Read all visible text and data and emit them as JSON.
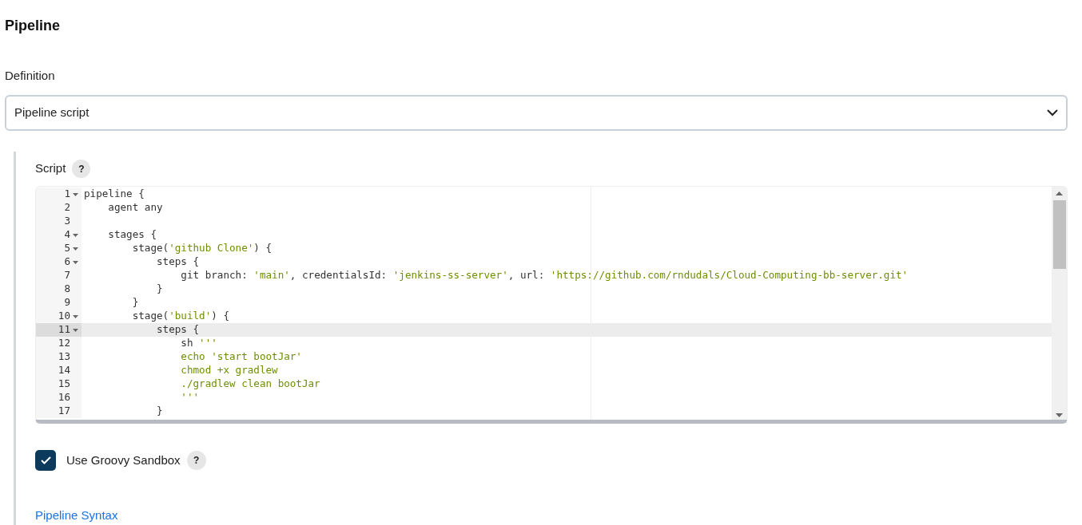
{
  "section_title": "Pipeline",
  "definition": {
    "label": "Definition",
    "value": "Pipeline script"
  },
  "script": {
    "label": "Script",
    "help": "?",
    "lines": [
      {
        "number": "1",
        "fold": true,
        "active": false,
        "segments": [
          {
            "kind": "plain",
            "text": "pipeline {"
          }
        ]
      },
      {
        "number": "2",
        "fold": false,
        "active": false,
        "segments": [
          {
            "kind": "plain",
            "text": "    agent any"
          }
        ]
      },
      {
        "number": "3",
        "fold": false,
        "active": false
      },
      {
        "number": "4",
        "fold": true,
        "active": false,
        "segments": [
          {
            "kind": "plain",
            "text": "    stages {"
          }
        ]
      },
      {
        "number": "5",
        "fold": true,
        "active": false,
        "segments": [
          {
            "kind": "plain",
            "text": "        stage("
          },
          {
            "kind": "string",
            "text": "'github Clone'"
          },
          {
            "kind": "plain",
            "text": ") {"
          }
        ]
      },
      {
        "number": "6",
        "fold": true,
        "active": false,
        "segments": [
          {
            "kind": "plain",
            "text": "            steps {"
          }
        ]
      },
      {
        "number": "7",
        "fold": false,
        "active": false,
        "segments": [
          {
            "kind": "plain",
            "text": "                git branch: "
          },
          {
            "kind": "string",
            "text": "'main'"
          },
          {
            "kind": "plain",
            "text": ", credentialsId: "
          },
          {
            "kind": "string",
            "text": "'jenkins-ss-server'"
          },
          {
            "kind": "plain",
            "text": ", url: "
          },
          {
            "kind": "string",
            "text": "'https://github.com/rndudals/Cloud-Computing-bb-server.git'"
          }
        ]
      },
      {
        "number": "8",
        "fold": false,
        "active": false,
        "segments": [
          {
            "kind": "plain",
            "text": "            }"
          }
        ]
      },
      {
        "number": "9",
        "fold": false,
        "active": false,
        "segments": [
          {
            "kind": "plain",
            "text": "        }"
          }
        ]
      },
      {
        "number": "10",
        "fold": true,
        "active": false,
        "segments": [
          {
            "kind": "plain",
            "text": "        stage("
          },
          {
            "kind": "string",
            "text": "'build'"
          },
          {
            "kind": "plain",
            "text": ") {"
          }
        ]
      },
      {
        "number": "11",
        "fold": true,
        "active": true,
        "segments": [
          {
            "kind": "plain",
            "text": "            steps {"
          }
        ]
      },
      {
        "number": "12",
        "fold": false,
        "active": false,
        "segments": [
          {
            "kind": "plain",
            "text": "                sh "
          },
          {
            "kind": "string",
            "text": "'''"
          }
        ]
      },
      {
        "number": "13",
        "fold": false,
        "active": false,
        "segments": [
          {
            "kind": "string",
            "text": "                echo 'start bootJar'"
          }
        ]
      },
      {
        "number": "14",
        "fold": false,
        "active": false,
        "segments": [
          {
            "kind": "string",
            "text": "                chmod +x gradlew"
          }
        ]
      },
      {
        "number": "15",
        "fold": false,
        "active": false,
        "segments": [
          {
            "kind": "string",
            "text": "                ./gradlew clean bootJar"
          }
        ]
      },
      {
        "number": "16",
        "fold": false,
        "active": false,
        "segments": [
          {
            "kind": "string",
            "text": "                '''"
          }
        ]
      },
      {
        "number": "17",
        "fold": false,
        "active": false,
        "segments": [
          {
            "kind": "plain",
            "text": "            }"
          }
        ]
      }
    ]
  },
  "sandbox": {
    "label": "Use Groovy Sandbox",
    "checked": true,
    "help": "?"
  },
  "syntax_link": "Pipeline Syntax"
}
